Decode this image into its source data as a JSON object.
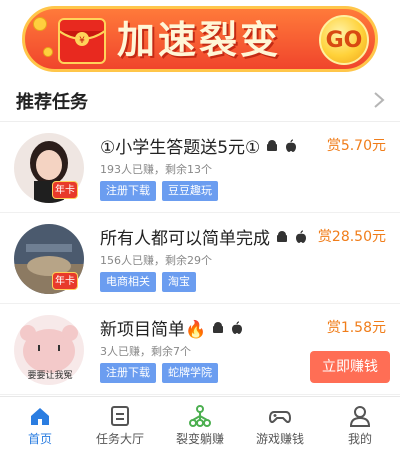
{
  "banner": {
    "title": "加速裂变",
    "go_label": "GO"
  },
  "section": {
    "title": "推荐任务"
  },
  "tasks": [
    {
      "title": "①小学生答题送5元①",
      "meta": "193人已赚，剩余13个",
      "tags": [
        "注册下载",
        "豆豆趣玩"
      ],
      "reward": "赏5.70元",
      "badge": "年卡"
    },
    {
      "title": "所有人都可以简单完成",
      "meta": "156人已赚，剩余29个",
      "tags": [
        "电商相关",
        "淘宝"
      ],
      "reward": "赏28.50元",
      "badge": "年卡"
    },
    {
      "title": "新项目简单🔥",
      "meta": "3人已赚，剩余7个",
      "tags": [
        "注册下载",
        "蛇牌学院"
      ],
      "reward": "赏1.58元",
      "button": "立即赚钱",
      "avatar_text": "要要让我冤"
    }
  ],
  "nav": [
    {
      "label": "首页",
      "icon": "home-icon",
      "active": true
    },
    {
      "label": "任务大厅",
      "icon": "task-list-icon",
      "active": false
    },
    {
      "label": "裂变躺赚",
      "icon": "share-tree-icon",
      "active": false
    },
    {
      "label": "游戏赚钱",
      "icon": "gamepad-icon",
      "active": false
    },
    {
      "label": "我的",
      "icon": "user-icon",
      "active": false
    }
  ],
  "colors": {
    "accent": "#2a7de1",
    "reward": "#f07d1a",
    "tag": "#6b9df0",
    "earn_button": "#ff6e55"
  }
}
